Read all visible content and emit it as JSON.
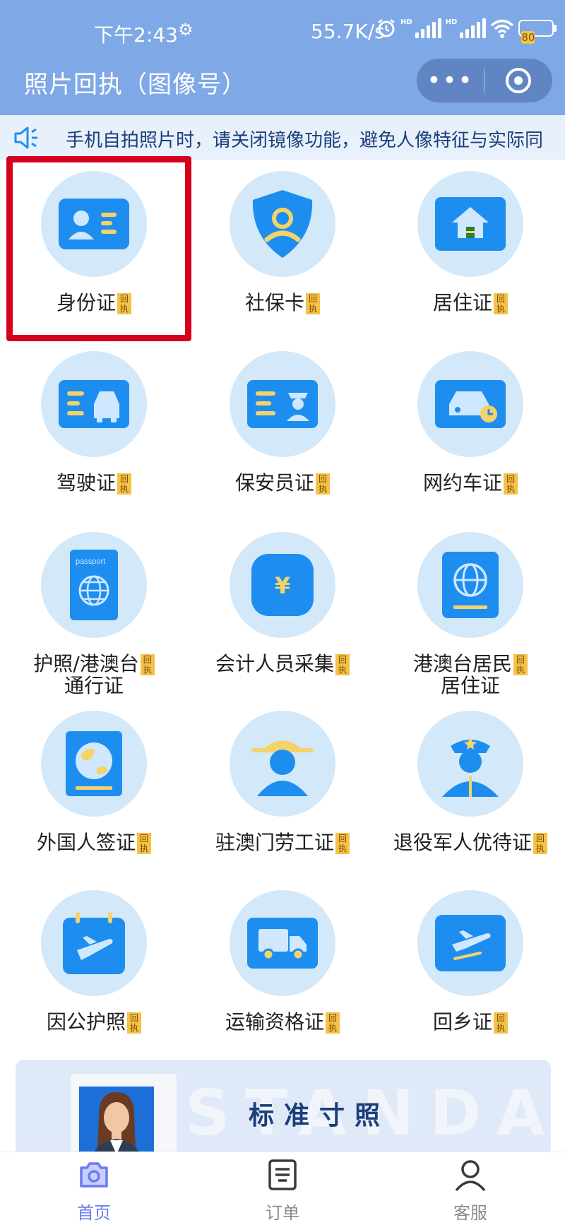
{
  "status_bar": {
    "time": "下午2:43",
    "net_speed": "55.7K/s",
    "hd1": "HD",
    "hd2": "HD",
    "battery": "80"
  },
  "header": {
    "title": "照片回执（图像号）",
    "more_label": "•••"
  },
  "notice": {
    "text": "手机自拍照片时，请关闭镜像功能，避免人像特征与实际同"
  },
  "tag_label": "回执",
  "items": [
    {
      "label": "身份证",
      "icon": "id-card-icon"
    },
    {
      "label": "社保卡",
      "icon": "social-security-shield-icon"
    },
    {
      "label": "居住证",
      "icon": "residence-house-icon"
    },
    {
      "label": "驾驶证",
      "icon": "driver-license-car-icon"
    },
    {
      "label": "保安员证",
      "icon": "security-guard-card-icon"
    },
    {
      "label": "网约车证",
      "icon": "ride-hailing-car-icon"
    },
    {
      "label1": "护照/港澳台",
      "label2": "通行证",
      "icon": "passport-icon",
      "passport_text": "passport"
    },
    {
      "label": "会计人员采集",
      "icon": "accountant-yuan-icon",
      "symbol": "¥"
    },
    {
      "label1": "港澳台居民",
      "label2": "居住证",
      "icon": "globe-card-icon"
    },
    {
      "label": "外国人签证",
      "icon": "foreigner-visa-globe-icon"
    },
    {
      "label": "驻澳门劳工证",
      "icon": "labor-worker-helmet-icon"
    },
    {
      "label": "退役军人优待证",
      "icon": "veteran-officer-icon"
    },
    {
      "label": "因公护照",
      "icon": "official-passport-plane-icon"
    },
    {
      "label": "运输资格证",
      "icon": "transport-truck-icon"
    },
    {
      "label": "回乡证",
      "icon": "home-return-plane-icon"
    }
  ],
  "banner": {
    "title": "标准寸照",
    "watermark": "STANDARD"
  },
  "tabbar": [
    {
      "label": "首页",
      "icon": "camera-icon",
      "active": true
    },
    {
      "label": "订单",
      "icon": "order-list-icon",
      "active": false
    },
    {
      "label": "客服",
      "icon": "customer-service-user-icon",
      "active": false
    }
  ],
  "colors": {
    "header": "#7fa8e6",
    "icon_bg": "#d3e8f9",
    "icon_blue": "#1d8ef0",
    "tag_yellow": "#f4c247",
    "highlight": "#d5001c",
    "tab_active": "#6b7cf2"
  }
}
